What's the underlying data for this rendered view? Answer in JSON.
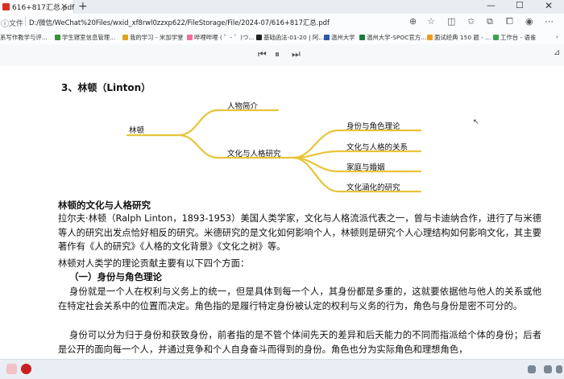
{
  "browser": {
    "tab_title": "616+817汇总.pdf",
    "address_label": "文件",
    "url": "D:/微信/WeChat%20Files/wxid_xf8rwl0zzxp622/FileStorage/File/2024-07/616+817汇总.pdf"
  },
  "bookmarks": [
    {
      "label": "系写作教学与评...",
      "color": "#4a7fd1"
    },
    {
      "label": "学生寝室信息管理...",
      "color": "#3a8f3a"
    },
    {
      "label": "我的学习 - 米加学堂",
      "color": "#e0a020"
    },
    {
      "label": "哔哩哔哩 ( ゜- ゜)つ...",
      "color": "#ef6f9a"
    },
    {
      "label": "基础函法-01-20 | 阿...",
      "color": "#222222"
    },
    {
      "label": "温州大学",
      "color": "#2a5aa8"
    },
    {
      "label": "温州大学-SPOC官方...",
      "color": "#1e7a3c"
    },
    {
      "label": "面试经典 150 题 - ...",
      "color": "#f09a20"
    },
    {
      "label": "工作台 - 语雀",
      "color": "#3aa356"
    }
  ],
  "pdf_toolbar": {
    "first": "⏮",
    "pause": "⏸",
    "next": "⏭"
  },
  "doc": {
    "section_title": "3、林顿（Linton）",
    "mindmap": {
      "root": "林顿",
      "branch1": "人物简介",
      "branch2": "文化与人格研究",
      "leaves": [
        "身份与角色理论",
        "文化与人格的关系",
        "家庭与婚姻",
        "文化涵化的研究"
      ],
      "line_color": "#e8c43a"
    },
    "heading": "林顿的文化与人格研究",
    "para1": "拉尔夫·林顿（Ralph Linton，1893-1953）美国人类学家，文化与人格流派代表之一，曾与卡迪纳合作，进行了与米德等人的研究出发点恰好相反的研究。米德研究的是文化如何影响个人，林顿则是研究个人心理结构如何影响文化，其主要著作有《人的研究》《人格的文化背景》《文化之树》等。",
    "para2": "林顿对人类学的理论贡献主要有以下四个方面：",
    "subheading": "（一）身份与角色理论",
    "para3": "身份就是一个人在权利与义务上的统一，但是具体到每一个人，其身份都是多重的，这就要依据他与他人的关系或他在特定社会关系中的位置而决定。角色指的是履行特定身份被认定的权利与义务的行为，角色与身份是密不可分的。",
    "para4": "身份可以分为归于身份和获致身份，前者指的是不管个体间先天的差异和后天能力的不同而指派给个体的身份；后者是公开的面向每一个人，并通过竞争和个人自身奋斗而得到的身份。角色也分为实际角色和理想角色，"
  }
}
